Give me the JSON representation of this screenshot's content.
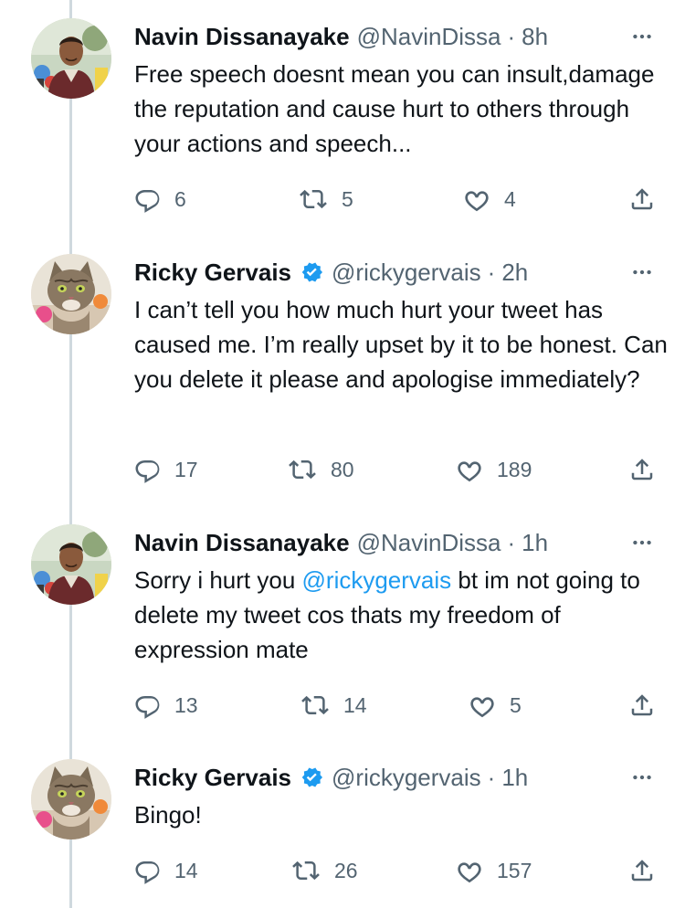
{
  "tweets": [
    {
      "name": "Navin Dissanayake",
      "verified": false,
      "handle": "@NavinDissa",
      "separator": "·",
      "time": "8h",
      "text": "Free speech doesnt mean you can insult,damage the reputation and cause hurt to others through your actions and speech...",
      "replies": "6",
      "retweets": "5",
      "likes": "4",
      "avatar": "person-photo"
    },
    {
      "name": "Ricky Gervais",
      "verified": true,
      "handle": "@rickygervais",
      "separator": "·",
      "time": "2h",
      "text": "I can’t tell you how much hurt your tweet has caused me. I’m really upset by it to be honest. Can you delete it please and apologise immediately?",
      "replies": "17",
      "retweets": "80",
      "likes": "189",
      "avatar": "cat-photo"
    },
    {
      "name": "Navin Dissanayake",
      "verified": false,
      "handle": "@NavinDissa",
      "separator": "·",
      "time": "1h",
      "text_before": "Sorry i hurt you ",
      "mention": "@rickygervais",
      "text_after": " bt im not going to delete my tweet cos thats my freedom of expression mate",
      "replies": "13",
      "retweets": "14",
      "likes": "5",
      "avatar": "person-photo"
    },
    {
      "name": "Ricky Gervais",
      "verified": true,
      "handle": "@rickygervais",
      "separator": "·",
      "time": "1h",
      "text": "Bingo!",
      "replies": "14",
      "retweets": "26",
      "likes": "157",
      "avatar": "cat-photo"
    }
  ],
  "colors": {
    "text": "#0f1419",
    "muted": "#536471",
    "link": "#1d9bf0",
    "verified": "#1d9bf0",
    "thread_line": "#cfd9de"
  },
  "icons": [
    "reply-icon",
    "retweet-icon",
    "like-icon",
    "share-icon",
    "more-icon",
    "verified-badge-icon"
  ]
}
